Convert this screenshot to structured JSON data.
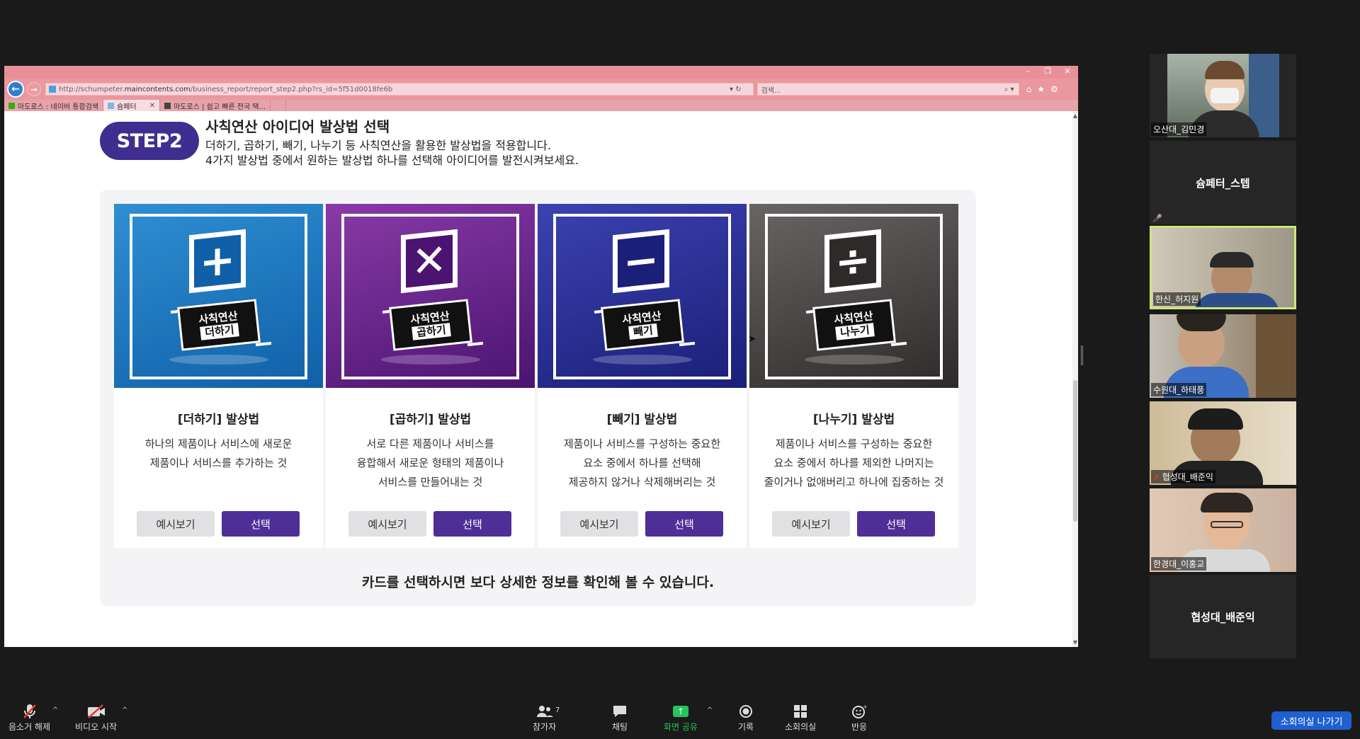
{
  "browser": {
    "url_prefix": "http://schumpeter.",
    "url_domain": "maincontents.com",
    "url_path": "/business_report/report_step2.php?rs_id=5f51d0018fe6b",
    "search_placeholder": "검색...",
    "tabs": [
      {
        "label": "마도로스 : 네이버 통합검색",
        "active": false
      },
      {
        "label": "슘페터",
        "active": true
      },
      {
        "label": "마도로스 | 쉽고 빠른 전국 택...",
        "active": false
      }
    ]
  },
  "step": {
    "badge": "STEP2",
    "title": "사칙연산 아이디어 발상법 선택",
    "desc1": "더하기, 곱하기, 빼기, 나누기 등 사칙연산을 활용한 발상법을 적용합니다.",
    "desc2": "4가지 발상법 중에서 원하는 발상법 하나를 선택해 아이디어를 발전시켜보세요."
  },
  "cards": [
    {
      "symbol": "+",
      "ribbon_top": "사칙연산",
      "ribbon_sub": "더하기",
      "title": "[더하기] 발상법",
      "desc_l1": "하나의 제품이나 서비스에 새로운",
      "desc_l2": "제품이나 서비스를 추가하는 것",
      "desc_l3": "",
      "example_label": "예시보기",
      "select_label": "선택",
      "color_top": "#2f8fd2",
      "color_bottom": "#1060a8"
    },
    {
      "symbol": "✕",
      "ribbon_top": "사칙연산",
      "ribbon_sub": "곱하기",
      "title": "[곱하기] 발상법",
      "desc_l1": "서로 다른 제품이나 서비스를",
      "desc_l2": "융합해서 새로운 형태의 제품이나",
      "desc_l3": "서비스를 만들어내는 것",
      "example_label": "예시보기",
      "select_label": "선택",
      "color_top": "#8a3aa8",
      "color_bottom": "#4a1470"
    },
    {
      "symbol": "−",
      "ribbon_top": "사칙연산",
      "ribbon_sub": "빼기",
      "title": "[빼기] 발상법",
      "desc_l1": "제품이나 서비스를 구성하는 중요한",
      "desc_l2": "요소 중에서 하나를 선택해",
      "desc_l3": "제공하지 않거나 삭제해버리는 것",
      "example_label": "예시보기",
      "select_label": "선택",
      "color_top": "#3c42b0",
      "color_bottom": "#1a1f78"
    },
    {
      "symbol": "÷",
      "ribbon_top": "사칙연산",
      "ribbon_sub": "나누기",
      "title": "[나누기] 발상법",
      "desc_l1": "제품이나 서비스를 구성하는 중요한",
      "desc_l2": "요소 중에서 하나를 제외한 나머지는",
      "desc_l3": "줄이거나 없애버리고 하나에 집중하는 것",
      "example_label": "예시보기",
      "select_label": "선택",
      "color_top": "#6a6565",
      "color_bottom": "#2e2a2a"
    }
  ],
  "bottom_note": "카드를 선택하시면 보다 상세한 정보를 확인해 볼 수 있습니다.",
  "participants": [
    {
      "label": "오산대_김민경",
      "type": "video"
    },
    {
      "label": "슘페터_스텝",
      "type": "name"
    },
    {
      "label": "한신_허지원",
      "type": "video"
    },
    {
      "label": "수원대_하태풍",
      "type": "video"
    },
    {
      "label": "협성대_배준익",
      "type": "video"
    },
    {
      "label": "한경대_이홍교",
      "type": "video"
    },
    {
      "label": "협성대_배준익",
      "type": "name"
    }
  ],
  "toolbar": {
    "mute": "음소거 해제",
    "video": "비디오 시작",
    "participants": "참가자",
    "participants_count": "7",
    "chat": "채팅",
    "share": "화면 공유",
    "record": "기록",
    "breakout": "소회의실",
    "reactions": "반응",
    "leave_breakout": "소회의실 나가기"
  }
}
